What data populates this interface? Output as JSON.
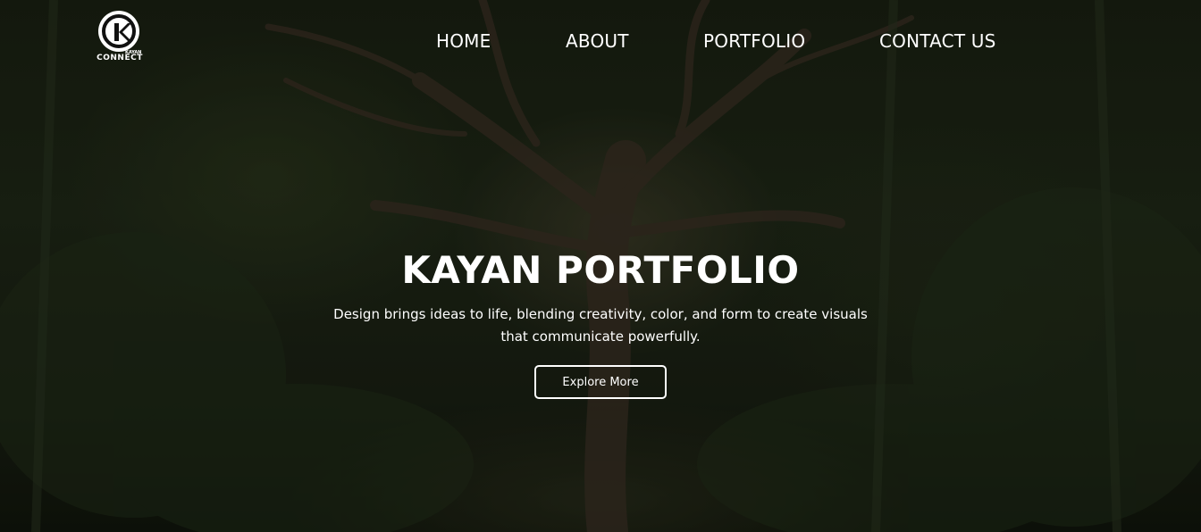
{
  "brand": {
    "logo_text": "CONNECT",
    "logo_small": "KAYAN",
    "logo_mark": "K"
  },
  "nav": {
    "items": [
      {
        "label": "HOME"
      },
      {
        "label": "ABOUT"
      },
      {
        "label": "PORTFOLIO"
      },
      {
        "label": "CONTACT US"
      }
    ]
  },
  "hero": {
    "title": "KAYAN PORTFOLIO",
    "description": "Design brings ideas to life, blending creativity, color, and form to create visuals that communicate powerfully.",
    "button_label": "Explore More",
    "background": "forest-tree-photo"
  },
  "colors": {
    "text": "#ffffff",
    "overlay": "#000000"
  }
}
